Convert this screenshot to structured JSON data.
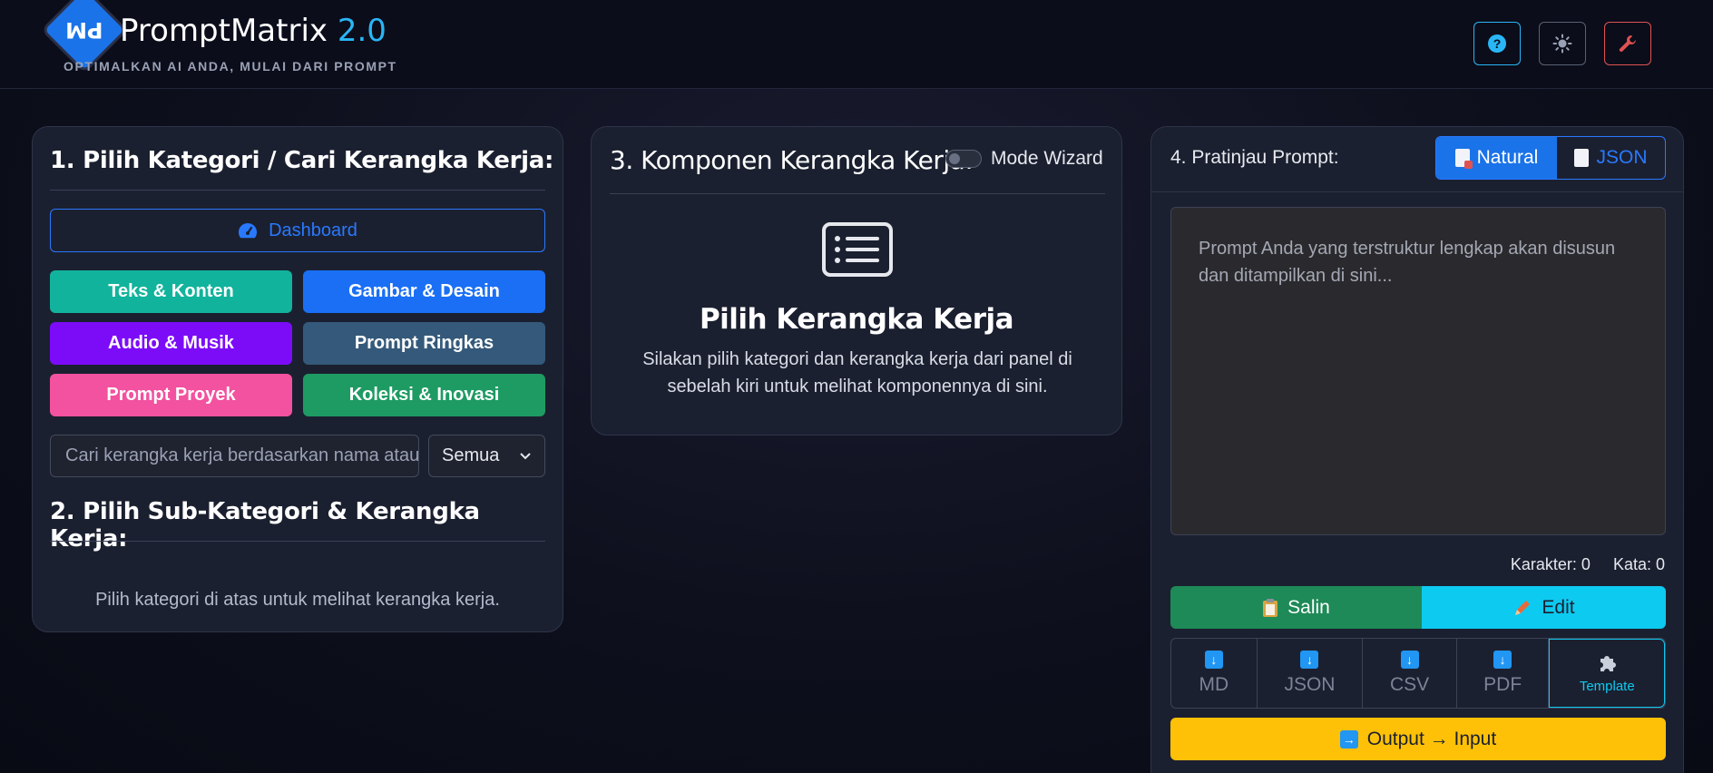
{
  "header": {
    "logo_text": "PM",
    "brand_name": "PromptMatrix",
    "brand_version": "2.0",
    "tagline": "OPTIMALKAN AI ANDA, MULAI DARI PROMPT",
    "help_glyph": "?",
    "icons": [
      "help-icon",
      "theme-icon",
      "wrench-icon"
    ],
    "colors": {
      "help": "#29b6f6",
      "tool": "#e05252"
    }
  },
  "panel1": {
    "title": "1. Pilih Kategori / Cari Kerangka Kerja:",
    "dashboard_label": "Dashboard",
    "categories": [
      {
        "label": "Teks & Konten",
        "color": "#12b39c"
      },
      {
        "label": "Gambar & Desain",
        "color": "#1a6ff5"
      },
      {
        "label": "Audio & Musik",
        "color": "#7c0cf8"
      },
      {
        "label": "Prompt Ringkas",
        "color": "#34597a"
      },
      {
        "label": "Prompt Proyek",
        "color": "#f2529f"
      },
      {
        "label": "Koleksi & Inovasi",
        "color": "#1e9b63"
      }
    ],
    "search_placeholder": "Cari kerangka kerja berdasarkan nama atau deskripsi...",
    "filter_value": "Semua",
    "sub_title": "2. Pilih Sub-Kategori & Kerangka Kerja:",
    "empty_text": "Pilih kategori di atas untuk melihat kerangka kerja."
  },
  "panel3": {
    "title": "3. Komponen Kerangka Kerja:",
    "wizard_label": "Mode Wizard",
    "placeholder_title": "Pilih Kerangka Kerja",
    "placeholder_desc": "Silakan pilih kategori dan kerangka kerja dari panel di sebelah kiri untuk melihat komponennya di sini."
  },
  "panel4": {
    "title": "4. Pratinjau Prompt:",
    "tab_natural": "Natural",
    "tab_json": "JSON",
    "textarea_placeholder": "Prompt Anda yang terstruktur lengkap akan disusun dan ditampilkan di sini...",
    "chars_label": "Karakter: 0",
    "words_label": "Kata: 0",
    "copy_label": "Salin",
    "edit_label": "Edit",
    "export": [
      "MD",
      "JSON",
      "CSV",
      "PDF"
    ],
    "template_label": "Template",
    "output_label": "Output → Input"
  }
}
